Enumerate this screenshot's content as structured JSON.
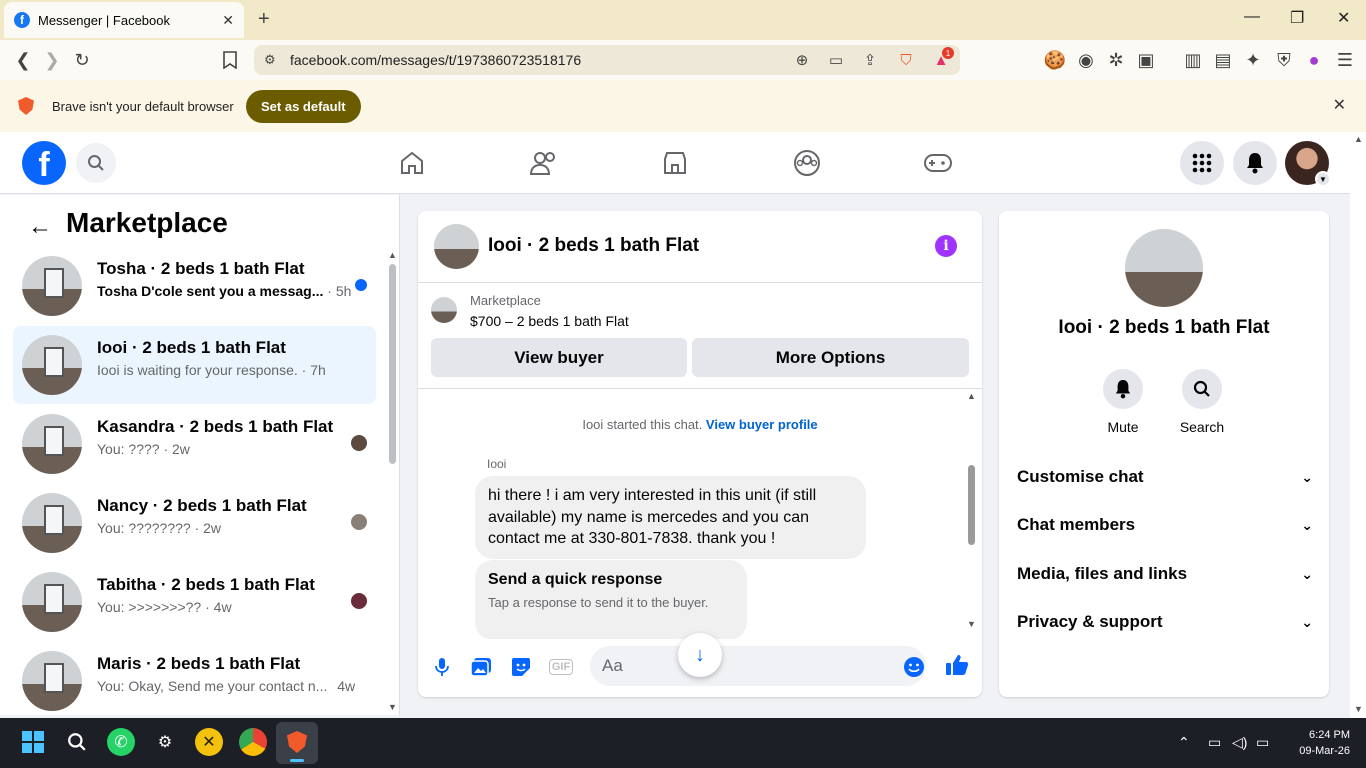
{
  "browser": {
    "tab_title": "Messenger | Facebook",
    "url": "facebook.com/messages/t/1973860723518176",
    "infobar_message": "Brave isn't your default browser",
    "infobar_button": "Set as default",
    "notification_count": "1"
  },
  "sidebar": {
    "title": "Marketplace",
    "conversations": [
      {
        "name": "Tosha · 2 beds 1 bath Flat",
        "preview": "Tosha D'cole sent you a messag...",
        "time": "· 5h",
        "unread": true
      },
      {
        "name": "Iooi · 2 beds 1 bath Flat",
        "preview": "Iooi is waiting for your response.",
        "time": "· 7h",
        "active": true
      },
      {
        "name": "Kasandra · 2 beds 1 bath Flat",
        "preview": "You: ????",
        "time": "· 2w"
      },
      {
        "name": "Nancy · 2 beds 1 bath Flat",
        "preview": "You: ????????",
        "time": "· 2w"
      },
      {
        "name": "Tabitha · 2 beds 1 bath Flat",
        "preview": "You: >>>>>>>??",
        "time": "· 4w"
      },
      {
        "name": "Maris · 2 beds 1 bath Flat",
        "preview": "You: Okay, Send me your contact n...",
        "time": "4w"
      }
    ]
  },
  "chat": {
    "title": "Iooi · 2 beds 1 bath Flat",
    "listing_label": "Marketplace",
    "listing_price": "$700 – 2 beds 1 bath Flat",
    "view_buyer": "View buyer",
    "more_options": "More Options",
    "system_message": "Iooi started this chat.",
    "system_link": "View buyer profile",
    "sender": "Iooi",
    "message": "hi there ! i am very interested in this unit (if still available) my name is mercedes and you can contact me at 330-801-7838. thank you !",
    "quick_title": "Send a quick response",
    "quick_subtitle": "Tap a response to send it to the buyer.",
    "composer_placeholder": "Aa"
  },
  "details": {
    "title": "Iooi · 2 beds 1 bath Flat",
    "mute": "Mute",
    "search": "Search",
    "rows": [
      "Customise chat",
      "Chat members",
      "Media, files and links",
      "Privacy & support"
    ]
  },
  "taskbar": {
    "time": "6:24 PM",
    "date": "09-Mar-26"
  },
  "colors": {
    "facebook_blue": "#0866ff",
    "active_row": "#ebf5ff",
    "brave_button": "#6b5c00"
  }
}
